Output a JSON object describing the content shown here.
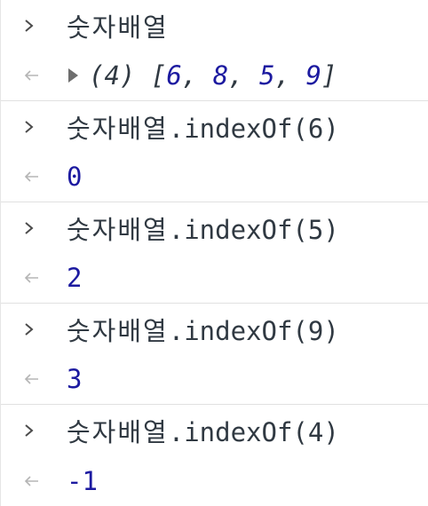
{
  "console": {
    "entries": [
      {
        "kind": "input",
        "expression": "숫자배열",
        "method": ""
      },
      {
        "kind": "result-array",
        "length": "(4)",
        "values": [
          "6",
          "8",
          "5",
          "9"
        ]
      },
      {
        "kind": "input",
        "expression": "숫자배열",
        "method": ".indexOf(6)"
      },
      {
        "kind": "result",
        "value": "0"
      },
      {
        "kind": "input",
        "expression": "숫자배열",
        "method": ".indexOf(5)"
      },
      {
        "kind": "result",
        "value": "2"
      },
      {
        "kind": "input",
        "expression": "숫자배열",
        "method": ".indexOf(9)"
      },
      {
        "kind": "result",
        "value": "3"
      },
      {
        "kind": "input",
        "expression": "숫자배열",
        "method": ".indexOf(4)"
      },
      {
        "kind": "result",
        "value": "-1"
      }
    ]
  },
  "colors": {
    "number": "#1c1aa0",
    "text": "#303942",
    "separator": "#e1e1e1"
  },
  "icons": {
    "input_prompt": "chevron-right-icon",
    "result_prompt": "return-arrow-icon",
    "expand": "expand-triangle-icon"
  }
}
